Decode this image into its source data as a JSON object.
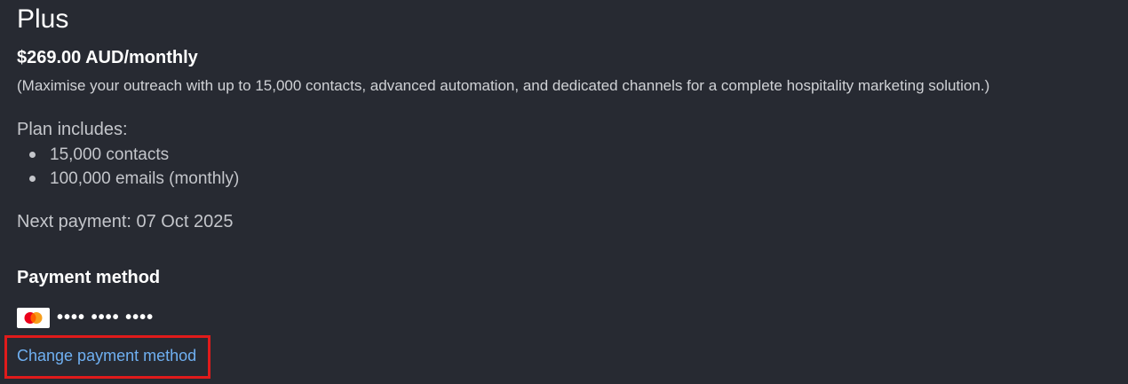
{
  "plan": {
    "name": "Plus",
    "price": "$269.00 AUD/monthly",
    "description": "(Maximise your outreach with up to 15,000 contacts, advanced automation, and dedicated channels for a complete hospitality marketing solution.)",
    "includes_heading": "Plan includes:",
    "includes": [
      "15,000 contacts",
      "100,000 emails (monthly)"
    ],
    "next_payment": "Next payment: 07 Oct 2025"
  },
  "payment": {
    "heading": "Payment method",
    "card_brand_icon": "mastercard-icon",
    "card_mask": "•••• •••• ••••",
    "change_link_label": "Change payment method"
  },
  "colors": {
    "background": "#272a32",
    "link": "#6fb0f2",
    "highlight_box": "#e01b1b"
  }
}
